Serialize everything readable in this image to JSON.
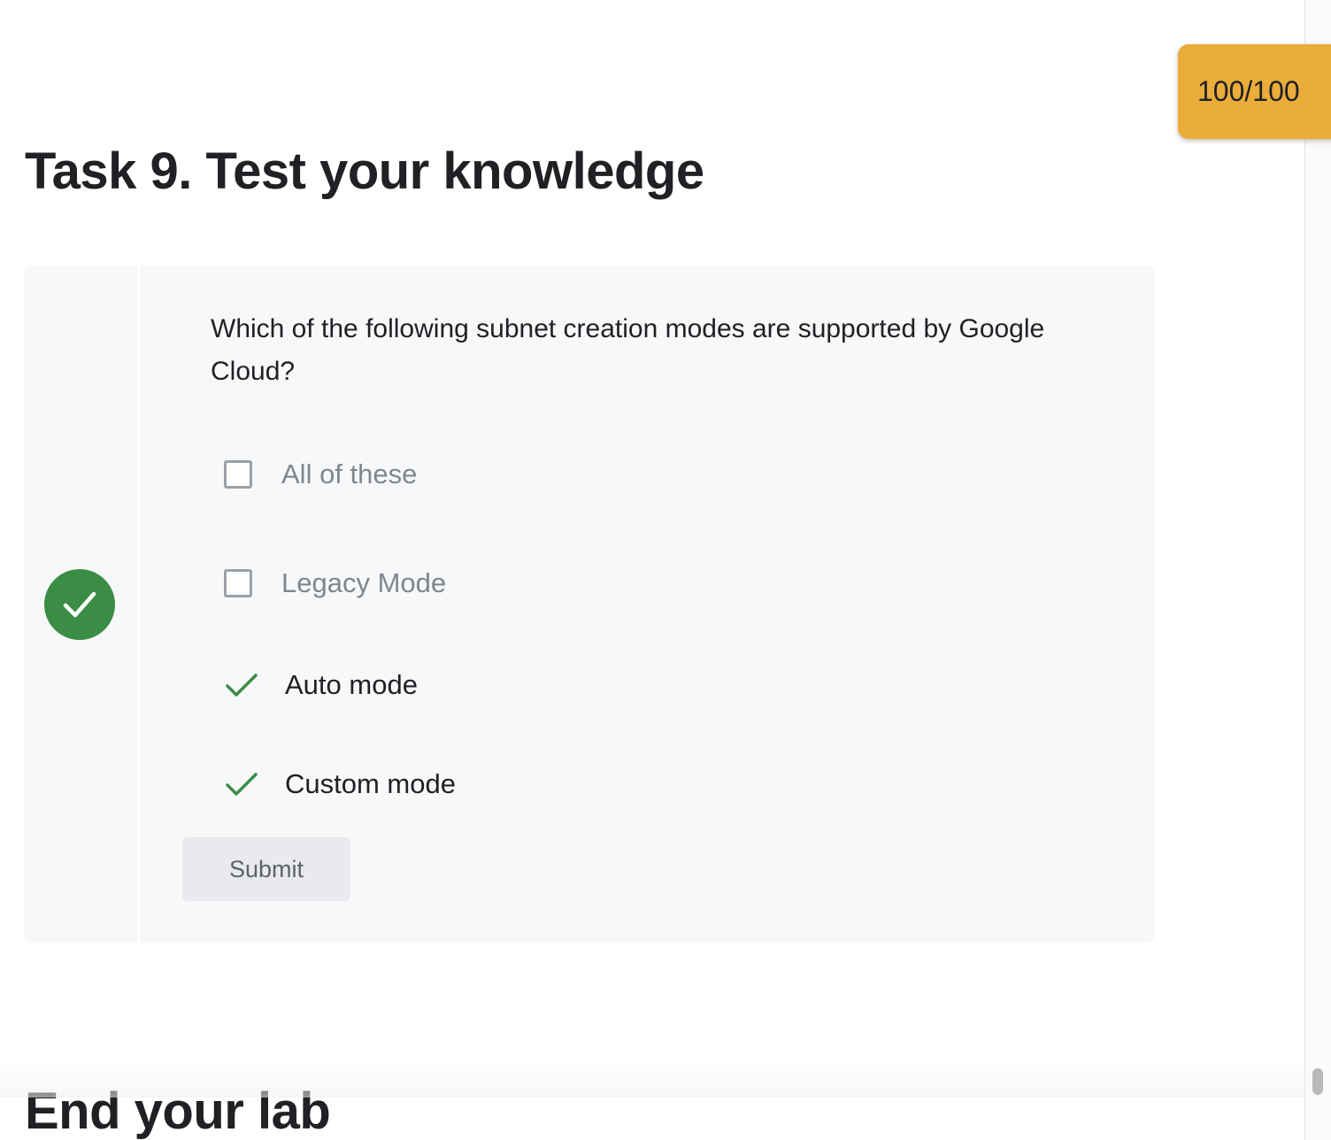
{
  "score": {
    "text": "100/100",
    "color": "#ebad3a"
  },
  "task": {
    "title": "Task 9. Test your knowledge"
  },
  "quiz": {
    "status": "correct",
    "status_icon": "check-icon",
    "status_color": "#3b8c45",
    "question": "Which of the following subnet creation modes are supported by Google Cloud?",
    "options": [
      {
        "label": "All of these",
        "selected": false
      },
      {
        "label": "Legacy Mode",
        "selected": false
      },
      {
        "label": "Auto mode",
        "selected": true
      },
      {
        "label": "Custom mode",
        "selected": true
      }
    ],
    "submit_label": "Submit"
  },
  "next_section": {
    "title": "End your lab"
  }
}
